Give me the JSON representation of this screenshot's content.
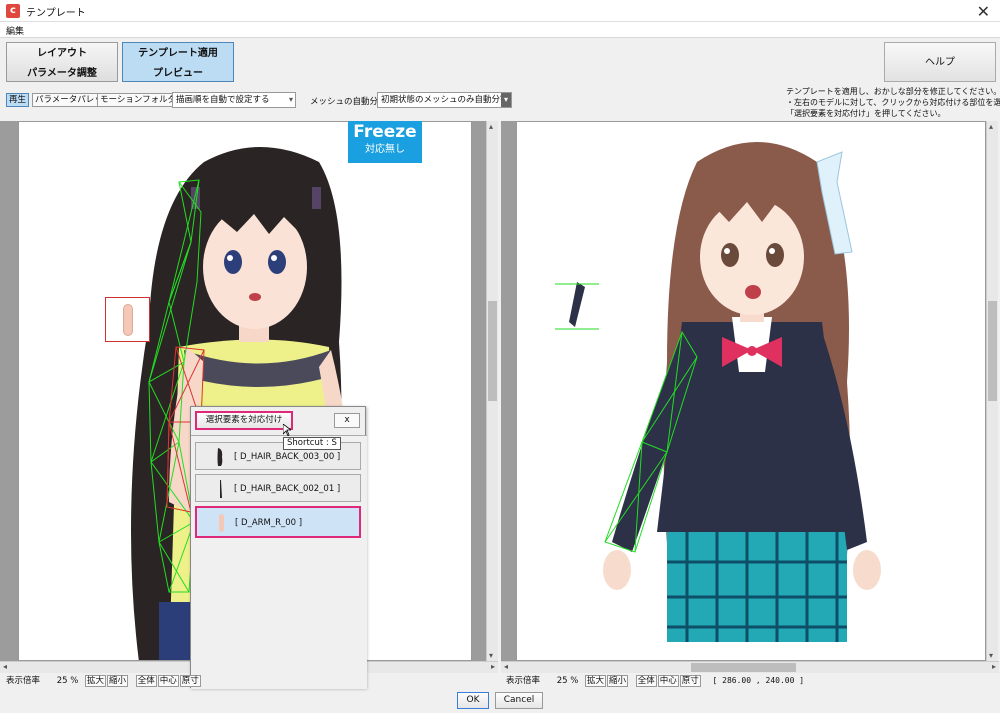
{
  "window": {
    "title": "テンプレート"
  },
  "menu": {
    "edit": "編集"
  },
  "toolbar": {
    "layout_line1": "レイアウト",
    "layout_line2": "パラメータ調整",
    "template_line1": "テンプレート適用",
    "template_line2": "プレビュー",
    "help": "ヘルプ",
    "play": "再生",
    "param_palette": "パラメータパレット",
    "motion_folder": "モーションフォルダ",
    "draw_order_select": "描画順を自動で設定する",
    "mesh_label": "メッシュの自動分割",
    "mesh_select": "初期状態のメッシュのみ自動分割"
  },
  "instructions": {
    "line1": "テンプレートを適用し、おかしな部分を修正してください。",
    "line2": "・左右のモデルに対して、クリックから対応付ける部位を選び、",
    "line3": "「選択要素を対応付け」を押してください。"
  },
  "freeze": {
    "title": "Freeze",
    "subtitle": "対応無し"
  },
  "popup": {
    "assign": "選択要素を対応付け",
    "close": "x",
    "tooltip": "Shortcut : S",
    "items": [
      {
        "label": "[ D_HAIR_BACK_003_00 ]"
      },
      {
        "label": "[ D_HAIR_BACK_002_01 ]"
      },
      {
        "label": "[ D_ARM_R_00 ]"
      }
    ]
  },
  "status_left": {
    "zoom_label": "表示倍率",
    "zoom_value": "25 %",
    "zoom_in": "拡大",
    "zoom_out": "縮小",
    "fit": "全体",
    "center": "中心",
    "original": "原寸"
  },
  "status_right": {
    "zoom_label": "表示倍率",
    "zoom_value": "25 %",
    "zoom_in": "拡大",
    "zoom_out": "縮小",
    "fit": "全体",
    "center": "中心",
    "original": "原寸",
    "coords": "[ 286.00 , 240.00 ]"
  },
  "footer": {
    "ok": "OK",
    "cancel": "Cancel"
  },
  "colors": {
    "accent_pink": "#e0287a",
    "freeze_blue": "#1aa0e0",
    "mesh_green": "#22dd22"
  }
}
